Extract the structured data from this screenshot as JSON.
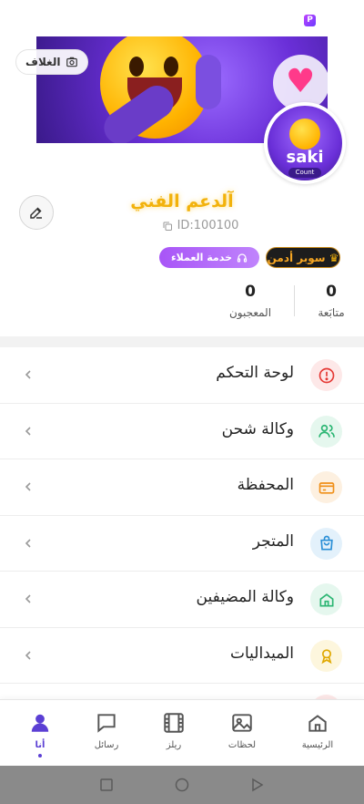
{
  "cover": {
    "change_cover_label": "الغلاف"
  },
  "avatar": {
    "logo_text": "saki",
    "logo_subtext": "Count"
  },
  "profile": {
    "name": "آلدعم الفني",
    "id_label": "ID:100100"
  },
  "badges": {
    "admin_label": "سوبر أدمن",
    "support_label": "خدمة العملاء"
  },
  "stats": {
    "following": {
      "value": "0",
      "label": "متابَعة"
    },
    "followers": {
      "value": "0",
      "label": "المعجبون"
    }
  },
  "menu": {
    "items": [
      {
        "label": "لوحة التحكم",
        "icon": "alert-circle-icon",
        "color": "#e53935",
        "bg": "#fde8e8"
      },
      {
        "label": "وكالة شحن",
        "icon": "users-icon",
        "color": "#2bb673",
        "bg": "#e5f7ee"
      },
      {
        "label": "المحفظة",
        "icon": "credit-card-icon",
        "color": "#f0901a",
        "bg": "#fdf0e0"
      },
      {
        "label": "المتجر",
        "icon": "shopping-bag-icon",
        "color": "#2a8fd6",
        "bg": "#e3f1fb"
      },
      {
        "label": "وكالة المضيفين",
        "icon": "home-icon",
        "color": "#2bb673",
        "bg": "#e5f7ee"
      },
      {
        "label": "الميداليات",
        "icon": "medal-icon",
        "color": "#e0a800",
        "bg": "#fdf6dd"
      }
    ]
  },
  "bottom_nav": {
    "items": [
      {
        "label": "الرئيسية",
        "icon": "home-icon"
      },
      {
        "label": "لحظات",
        "icon": "image-icon"
      },
      {
        "label": "ريلز",
        "icon": "film-icon"
      },
      {
        "label": "رسائل",
        "icon": "chat-icon"
      },
      {
        "label": "أنا",
        "icon": "user-icon",
        "active": true
      }
    ]
  },
  "colors": {
    "accent": "#5b3fd4",
    "name_gold": "#f2b20c",
    "admin_text": "#f6a623",
    "support_purple": "#a855f7"
  }
}
